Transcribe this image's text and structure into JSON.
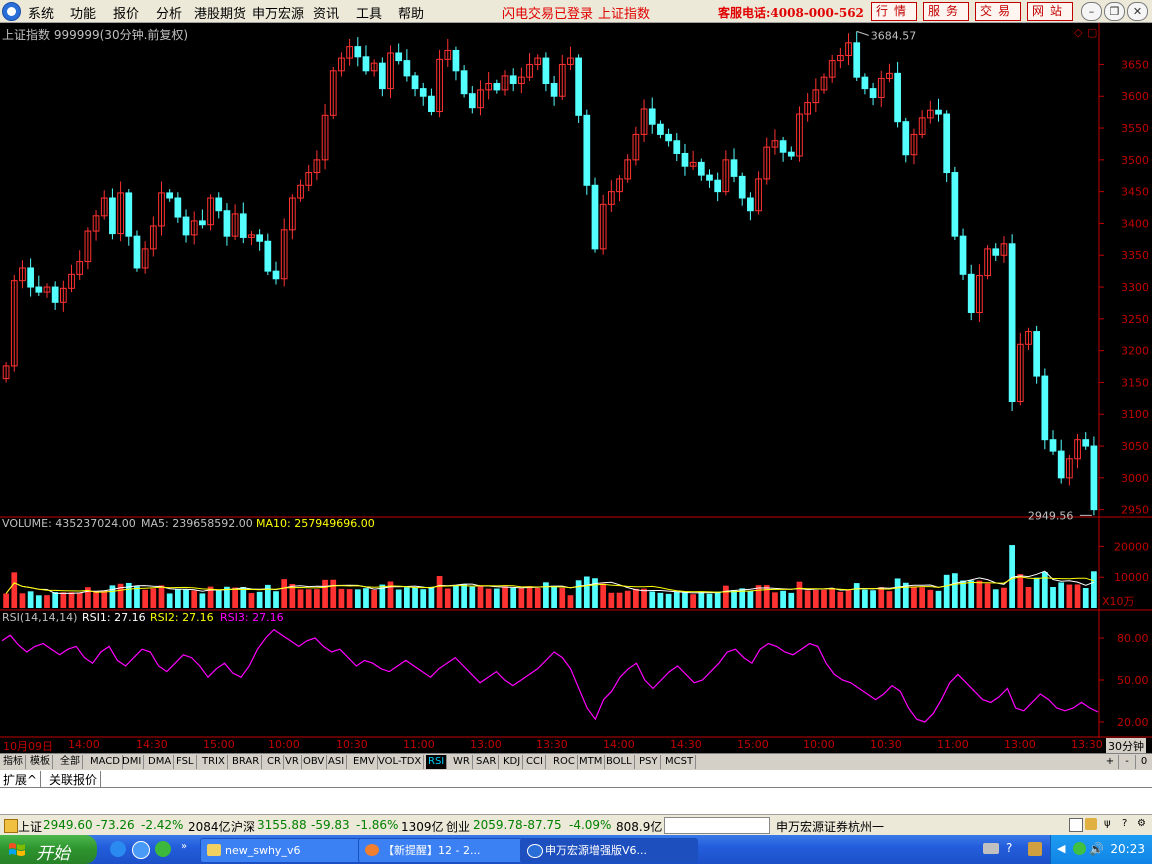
{
  "menubar": {
    "items": [
      "系统",
      "功能",
      "报价",
      "分析",
      "港股期货",
      "申万宏源",
      "资讯",
      "工具",
      "帮助"
    ],
    "flash_login": "闪电交易已登录",
    "index_link": "上证指数",
    "hotline": "客服电话:4008-000-562",
    "buttons": [
      "行情",
      "服务",
      "交易",
      "网站"
    ]
  },
  "price_pane": {
    "title": "上证指数 999999(30分钟.前复权)",
    "high_marker": "3684.57",
    "low_marker": "2949.56",
    "y_ticks": [
      "3650",
      "3600",
      "3550",
      "3500",
      "3450",
      "3400",
      "3350",
      "3300",
      "3250",
      "3200",
      "3150",
      "3100",
      "3050",
      "3000",
      "2950"
    ]
  },
  "volume_pane": {
    "label_volume": "VOLUME: 435237024.00",
    "label_ma5": "MA5: 239658592.00",
    "label_ma10": "MA10: 257949696.00",
    "y_ticks": [
      "20000",
      "10000"
    ],
    "unit": "X10万"
  },
  "rsi_pane": {
    "label_name": "RSI(14,14,14)",
    "label_rsi1": "RSI1: 27.16",
    "label_rsi2": "RSI2: 27.16",
    "label_rsi3": "RSI3: 27.16",
    "y_ticks": [
      "80.00",
      "50.00",
      "20.00"
    ]
  },
  "time_axis": {
    "labels": [
      "10月09日",
      "14:00",
      "14:30",
      "15:00",
      "10:00",
      "10:30",
      "11:00",
      "13:00",
      "13:30",
      "14:00",
      "14:30",
      "15:00",
      "10:00",
      "10:30",
      "11:00",
      "13:00",
      "13:30"
    ],
    "period": "30分钟"
  },
  "indicator_tabs": [
    "指标",
    "模板",
    "全部",
    "MACD",
    "DMI",
    "DMA",
    "FSL",
    "TRIX",
    "BRAR",
    "CR",
    "VR",
    "OBV",
    "ASI",
    "EMV",
    "VOL-TDX",
    "RSI",
    "WR",
    "SAR",
    "KDJ",
    "CCI",
    "ROC",
    "MTM",
    "BOLL",
    "PSY",
    "MCST"
  ],
  "selected_tab": "RSI",
  "expand_row": [
    "扩展^",
    "关联报价"
  ],
  "statusbar": {
    "sh_name": "上证",
    "sh_value": "2949.60",
    "sh_change": "-73.26",
    "sh_pct": "-2.42%",
    "sh_amount": "2084亿",
    "hs_name": "沪深",
    "hs_value": "3155.88",
    "hs_change": "-59.83",
    "hs_pct": "-1.86%",
    "hs_amount": "1309亿",
    "cy_name": "创业",
    "cy_value": "2059.78",
    "cy_change": "-87.75",
    "cy_pct": "-4.09%",
    "cy_amount": "808.9亿",
    "broker": "申万宏源证券杭州一"
  },
  "taskbar": {
    "start": "开始",
    "tasks": [
      "new_swhy_v6",
      "【新提醒】12 - 2...",
      "申万宏源增强版V6..."
    ],
    "clock": "20:23"
  },
  "colors": {
    "up": "#ff3232",
    "down": "#54ffff",
    "rsi": "#ff00ff",
    "ma5": "#ffffff",
    "ma10": "#ffff00",
    "axis": "#c00000"
  },
  "chart_data": {
    "type": "candlestick",
    "price_range": [
      2940,
      3690
    ],
    "closes": [
      3176,
      3310,
      3330,
      3300,
      3292,
      3300,
      3276,
      3298,
      3320,
      3340,
      3388,
      3412,
      3440,
      3384,
      3448,
      3380,
      3330,
      3360,
      3396,
      3448,
      3440,
      3410,
      3382,
      3404,
      3398,
      3440,
      3420,
      3380,
      3415,
      3378,
      3382,
      3372,
      3325,
      3313,
      3390,
      3440,
      3460,
      3480,
      3500,
      3570,
      3640,
      3660,
      3678,
      3662,
      3640,
      3652,
      3612,
      3668,
      3656,
      3632,
      3612,
      3600,
      3576,
      3658,
      3672,
      3640,
      3604,
      3582,
      3610,
      3620,
      3610,
      3632,
      3620,
      3630,
      3650,
      3660,
      3620,
      3600,
      3650,
      3660,
      3570,
      3460,
      3360,
      3430,
      3450,
      3470,
      3500,
      3540,
      3580,
      3556,
      3540,
      3530,
      3510,
      3490,
      3496,
      3476,
      3468,
      3450,
      3500,
      3474,
      3440,
      3420,
      3470,
      3520,
      3530,
      3512,
      3506,
      3572,
      3590,
      3610,
      3630,
      3656,
      3664,
      3684,
      3630,
      3612,
      3598,
      3628,
      3636,
      3560,
      3508,
      3540,
      3566,
      3578,
      3572,
      3480,
      3380,
      3320,
      3260,
      3318,
      3360,
      3350,
      3368,
      3120,
      3210,
      3230,
      3160,
      3060,
      3042,
      3000,
      3030,
      3060,
      3050,
      2950
    ],
    "volume_ticks": [
      20000,
      10000
    ],
    "rsi": [
      78,
      82,
      75,
      70,
      74,
      76,
      72,
      68,
      72,
      74,
      66,
      62,
      70,
      74,
      64,
      60,
      66,
      72,
      70,
      60,
      56,
      62,
      68,
      66,
      60,
      52,
      58,
      62,
      55,
      52,
      60,
      72,
      80,
      86,
      82,
      78,
      74,
      78,
      80,
      74,
      70,
      72,
      66,
      60,
      64,
      62,
      58,
      56,
      60,
      64,
      60,
      56,
      52,
      58,
      62,
      66,
      60,
      54,
      48,
      52,
      56,
      50,
      46,
      50,
      54,
      58,
      64,
      70,
      66,
      58,
      44,
      30,
      22,
      36,
      42,
      52,
      58,
      62,
      50,
      44,
      50,
      56,
      60,
      54,
      48,
      50,
      56,
      62,
      70,
      72,
      66,
      62,
      72,
      76,
      74,
      70,
      68,
      72,
      76,
      74,
      62,
      54,
      50,
      48,
      44,
      40,
      36,
      40,
      46,
      42,
      30,
      22,
      20,
      26,
      36,
      48,
      54,
      48,
      42,
      36,
      34,
      38,
      44,
      30,
      28,
      34,
      40,
      36,
      30,
      28,
      30,
      34,
      30,
      27.16
    ],
    "rsi_ticks": [
      80,
      50,
      20
    ]
  }
}
